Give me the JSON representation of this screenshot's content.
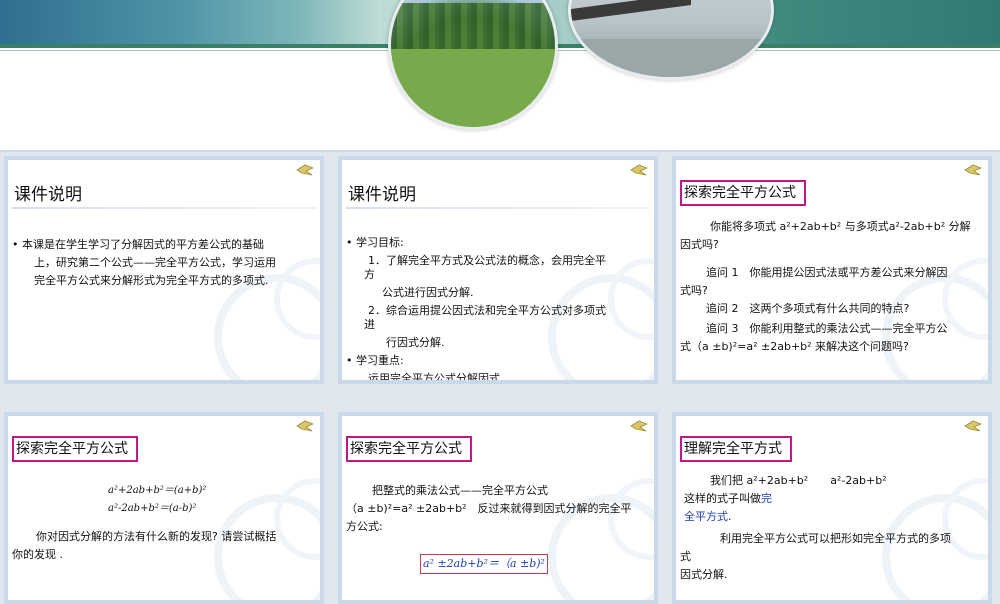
{
  "slides": [
    {
      "title": "课件说明",
      "lines": [
        "• 本课是在学生学习了分解因式的平方差公式的基础",
        "上，研究第二个公式——完全平方公式，学习运用",
        "完全平方公式来分解形式为完全平方式的多项式."
      ]
    },
    {
      "title": "课件说明",
      "lines": [
        "• 学习目标:",
        "1．了解完全平方式及公式法的概念，会用完全平",
        "方",
        "公式进行因式分解.",
        "2．综合运用提公因式法和完全平方公式对多项式",
        "进",
        "行因式分解.",
        "• 学习重点:",
        "运用完全平方公式分解因式."
      ]
    },
    {
      "title": "探索完全平方公式",
      "lines": [
        "你能将多项式 a²+2ab+b² 与多项式a²-2ab+b² 分解",
        "因式吗?",
        "追问 1　你能用提公因式法或平方差公式来分解因",
        "式吗?",
        "追问 2　这两个多项式有什么共同的特点?",
        "追问 3　你能利用整式的乘法公式——完全平方公",
        "式（a ±b)²=a² ±2ab+b² 来解决这个问题吗?"
      ]
    },
    {
      "title": "探索完全平方公式",
      "lines": [
        "a²+2ab+b²＝(a+b)²",
        "a²-2ab+b²＝(a-b)²",
        "你对因式分解的方法有什么新的发现? 请尝试概括",
        "你的发现 ."
      ]
    },
    {
      "title": "探索完全平方公式",
      "lines": [
        "把整式的乘法公式——完全平方公式",
        "（a ±b)²=a² ±2ab+b²　反过来就得到因式分解的完全平",
        "方公式:",
        "a² ±2ab+b²＝（a ±b)²"
      ]
    },
    {
      "title": "理解完全平方式",
      "lines": [
        "我们把 a²+2ab+b²　　a²-2ab+b²",
        "这样的式子叫做",
        "完",
        "全平方式",
        ".",
        "利用完全平方公式可以把形如完全平方式的多项",
        "式",
        "因式分解."
      ]
    }
  ]
}
